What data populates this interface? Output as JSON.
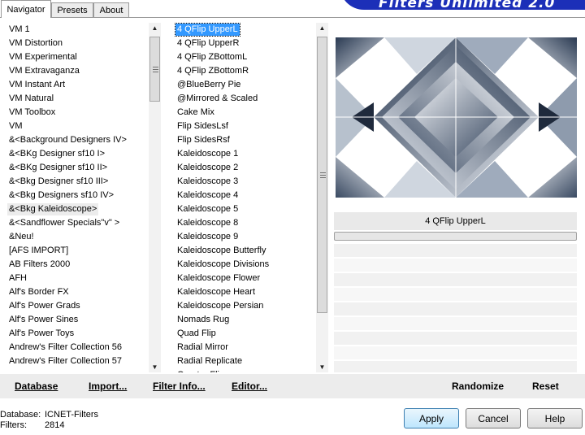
{
  "tabs": [
    "Navigator",
    "Presets",
    "About"
  ],
  "banner": {
    "title": "Filters Unlimited 2.0"
  },
  "categories": [
    "VM 1",
    "VM Distortion",
    "VM Experimental",
    "VM Extravaganza",
    "VM Instant Art",
    "VM Natural",
    "VM Toolbox",
    "VM",
    "&<Background Designers IV>",
    "&<BKg Designer sf10 I>",
    "&<BKg Designer sf10 II>",
    "&<Bkg Designer sf10 III>",
    "&<Bkg Designers sf10 IV>",
    "&<Bkg Kaleidoscope>",
    "&<Sandflower Specials\"v\" >",
    "&Neu!",
    "[AFS IMPORT]",
    "AB Filters 2000",
    "AFH",
    "Alf's Border FX",
    "Alf's Power Grads",
    "Alf's Power Sines",
    "Alf's Power Toys",
    "Andrew's Filter Collection 56",
    "Andrew's Filter Collection 57"
  ],
  "categories_highlight_index": 13,
  "filters": [
    "4 QFlip UpperL",
    "4 QFlip UpperR",
    "4 QFlip ZBottomL",
    "4 QFlip ZBottomR",
    "@BlueBerry Pie",
    "@Mirrored & Scaled",
    "Cake Mix",
    "Flip SidesLsf",
    "Flip SidesRsf",
    "Kaleidoscope 1",
    "Kaleidoscope 2",
    "Kaleidoscope 3",
    "Kaleidoscope 4",
    "Kaleidoscope 5",
    "Kaleidoscope 8",
    "Kaleidoscope 9",
    "Kaleidoscope Butterfly",
    "Kaleidoscope Divisions",
    "Kaleidoscope Flower",
    "Kaleidoscope Heart",
    "Kaleidoscope Persian",
    "Nomads Rug",
    "Quad Flip",
    "Radial Mirror",
    "Radial Replicate",
    "Quarter Flip"
  ],
  "filters_selected_index": 0,
  "preview": {
    "filter_name": "4 QFlip UpperL"
  },
  "bottom": {
    "database_label": "Database",
    "import_label": "Import...",
    "filter_info_label": "Filter Info...",
    "editor_label": "Editor...",
    "randomize_label": "Randomize",
    "reset_label": "Reset"
  },
  "info": {
    "database_key": "Database:",
    "database_value": "ICNET-Filters",
    "filters_key": "Filters:",
    "filters_value": "2814"
  },
  "buttons": {
    "apply": "Apply",
    "cancel": "Cancel",
    "help": "Help"
  },
  "colors": {
    "selection": "#3399ff",
    "banner": "#1c2fb8",
    "primary_button": "#bee6fd"
  }
}
